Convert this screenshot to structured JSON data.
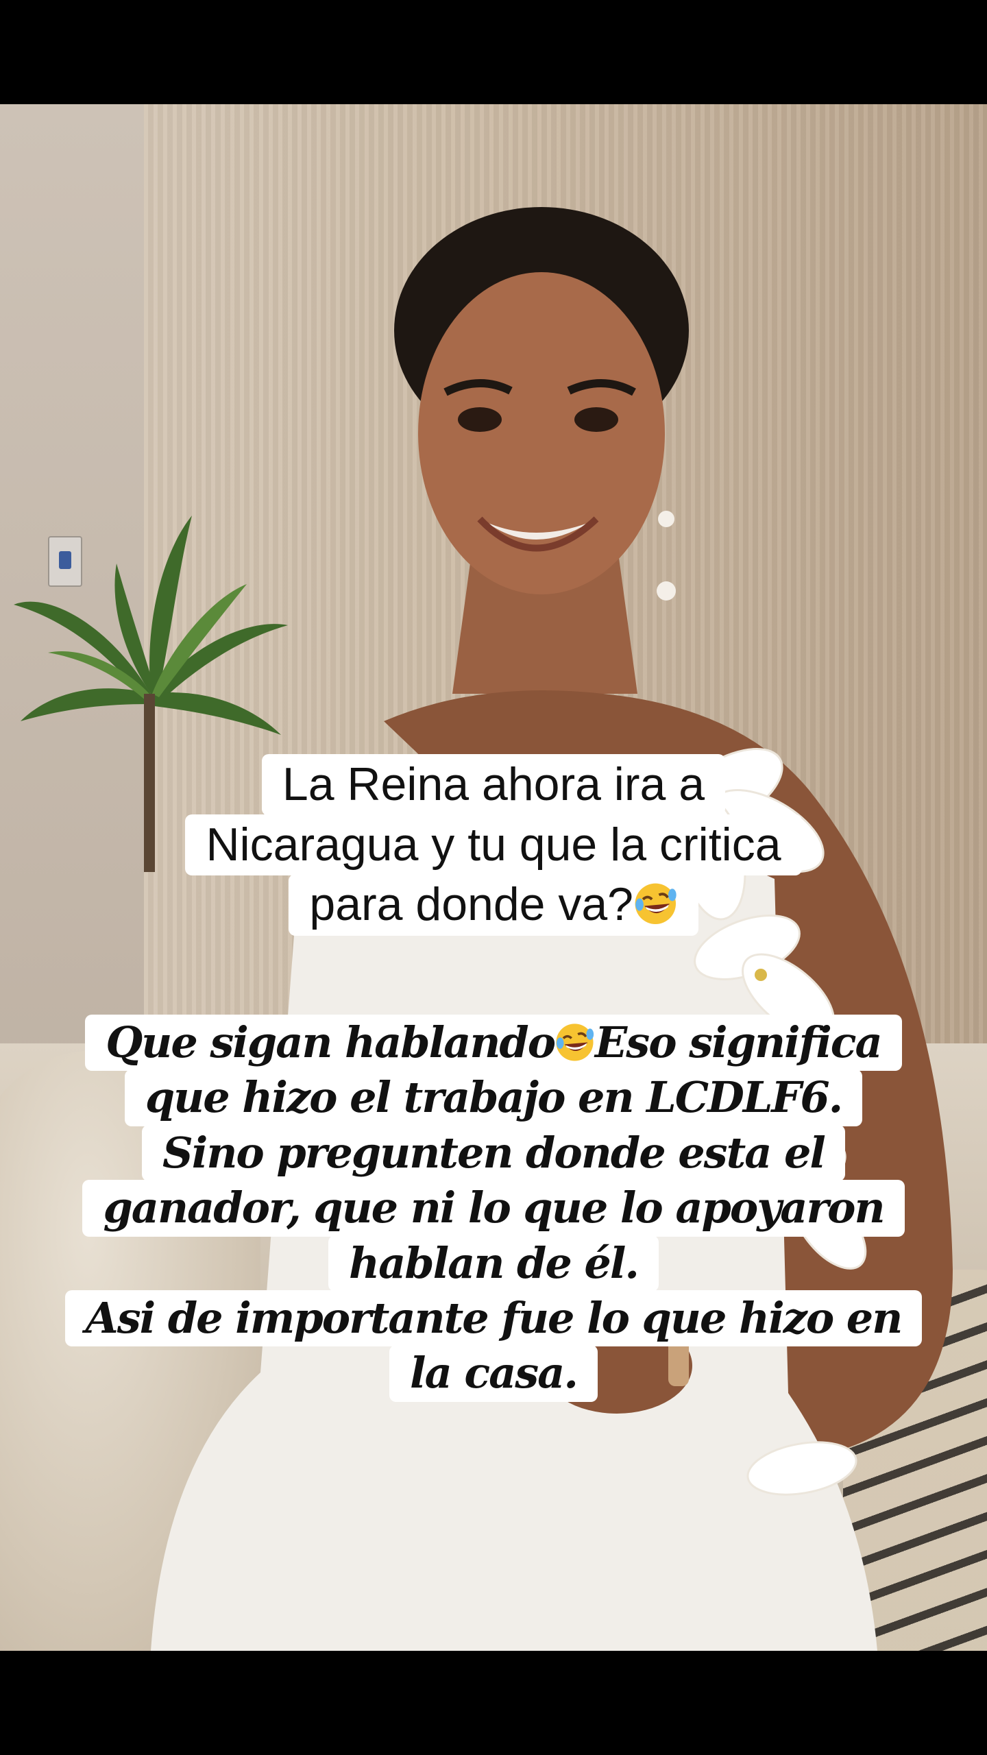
{
  "video": {
    "caption_top": {
      "lines": [
        "La Reina ahora ira a",
        "Nicaragua y tu que la critica",
        "para donde va?"
      ],
      "emoji": "rolling-on-floor-laughing"
    },
    "caption_main": {
      "lines": [
        "Que sigan hablando",
        "Eso significa",
        "que hizo el trabajo en LCDLF6.",
        "Sino pregunten donde esta el",
        "ganador, que ni lo que lo apoyaron",
        "hablan de él.",
        "Asi de importante fue lo que hizo en",
        "la casa."
      ],
      "emoji": "rolling-on-floor-laughing"
    }
  },
  "colors": {
    "caption_bg": "#ffffff",
    "caption_text": "#111111",
    "letterbox": "#000000"
  }
}
